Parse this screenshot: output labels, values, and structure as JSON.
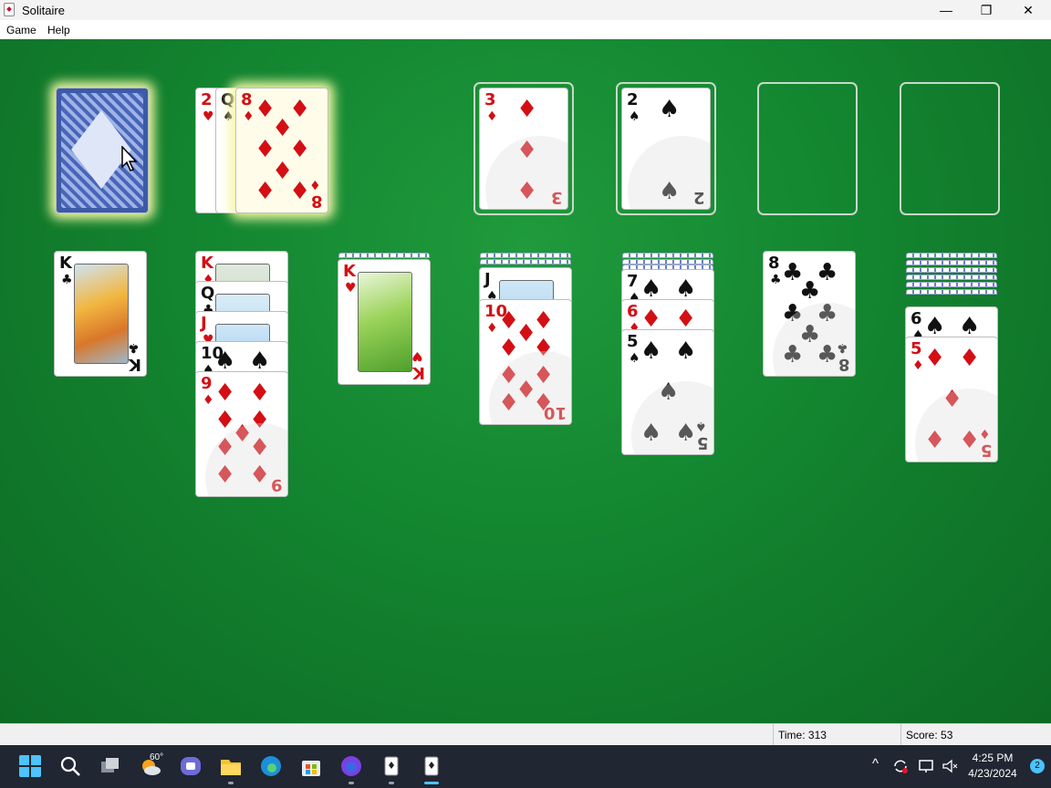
{
  "window": {
    "title": "Solitaire",
    "minimize_glyph": "—",
    "restore_glyph": "❐",
    "close_glyph": "✕"
  },
  "menu": {
    "game": "Game",
    "help": "Help"
  },
  "stock": {
    "state": "face-down"
  },
  "waste": [
    {
      "rank": "2",
      "suit": "♥",
      "color": "red"
    },
    {
      "rank": "Q",
      "suit": "♠",
      "color": "black"
    },
    {
      "rank": "8",
      "suit": "♦",
      "color": "red"
    }
  ],
  "foundations": [
    {
      "rank": "3",
      "suit": "♦",
      "color": "red"
    },
    {
      "rank": "2",
      "suit": "♠",
      "color": "black"
    },
    {
      "rank": "",
      "suit": "",
      "color": ""
    },
    {
      "rank": "",
      "suit": "",
      "color": ""
    }
  ],
  "tableau": [
    {
      "hidden": 0,
      "cards": [
        {
          "rank": "K",
          "suit": "♣",
          "color": "black"
        }
      ]
    },
    {
      "hidden": 0,
      "cards": [
        {
          "rank": "K",
          "suit": "♦",
          "color": "red"
        },
        {
          "rank": "Q",
          "suit": "♣",
          "color": "black"
        },
        {
          "rank": "J",
          "suit": "♥",
          "color": "red"
        },
        {
          "rank": "10",
          "suit": "♠",
          "color": "black"
        },
        {
          "rank": "9",
          "suit": "♦",
          "color": "red"
        }
      ]
    },
    {
      "hidden": 1,
      "cards": [
        {
          "rank": "K",
          "suit": "♥",
          "color": "red"
        }
      ]
    },
    {
      "hidden": 2,
      "cards": [
        {
          "rank": "J",
          "suit": "♠",
          "color": "black"
        },
        {
          "rank": "10",
          "suit": "♦",
          "color": "red"
        }
      ]
    },
    {
      "hidden": 3,
      "cards": [
        {
          "rank": "7",
          "suit": "♠",
          "color": "black"
        },
        {
          "rank": "6",
          "suit": "♦",
          "color": "red"
        },
        {
          "rank": "5",
          "suit": "♠",
          "color": "black"
        }
      ]
    },
    {
      "hidden": 0,
      "cards": [
        {
          "rank": "8",
          "suit": "♣",
          "color": "black"
        }
      ]
    },
    {
      "hidden": 6,
      "cards": [
        {
          "rank": "6",
          "suit": "♠",
          "color": "black"
        },
        {
          "rank": "5",
          "suit": "♦",
          "color": "red"
        }
      ]
    }
  ],
  "status": {
    "time_label": "Time:",
    "time_value": "313",
    "score_label": "Score:",
    "score_value": "53"
  },
  "taskbar": {
    "weather_temp": "60°",
    "clock_time": "4:25 PM",
    "clock_date": "4/23/2024",
    "notification_count": "2",
    "tray_chevron": "^"
  },
  "colors": {
    "felt": "#138530",
    "red_suit": "#d30f14",
    "taskbar": "#202632"
  }
}
